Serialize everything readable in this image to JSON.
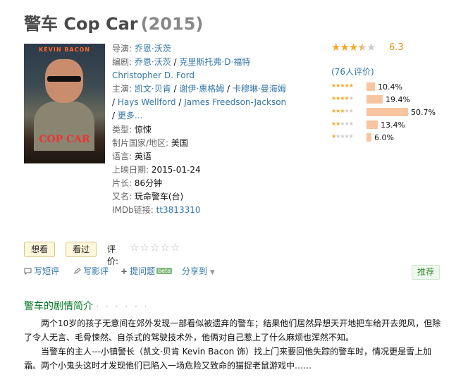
{
  "title": {
    "cn": "警车 Cop Car",
    "year": "(2015)"
  },
  "poster": {
    "actor": "KEVIN BACON",
    "name": "COP CAR"
  },
  "info": {
    "director_label": "导演:",
    "director": "乔恩·沃茨",
    "writer_label": "编剧:",
    "writer1": "乔恩·沃茨",
    "writer2": "克里斯托弗·D·福特 Christopher D. Ford",
    "cast_label": "主演:",
    "cast1": "凯文·贝肯",
    "cast2": "谢伊·惠格姆",
    "cast3": "卡穆琳·曼海姆",
    "cast4": "Hays Wellford",
    "cast5": "James Freedson-Jackson",
    "more": "更多...",
    "genre_label": "类型:",
    "genre": "惊悚",
    "country_label": "制片国家/地区:",
    "country": "美国",
    "lang_label": "语言:",
    "lang": "英语",
    "release_label": "上映日期:",
    "release": "2015-01-24",
    "runtime_label": "片长:",
    "runtime": "86分钟",
    "aka_label": "又名:",
    "aka": "玩命警车(台)",
    "imdb_label": "IMDb链接:",
    "imdb": "tt3813310"
  },
  "rating": {
    "score": "6.3",
    "stars_value": 3.5,
    "votes": "(76人评价)",
    "distribution": [
      {
        "stars": 5,
        "percent": 10.4,
        "label": "10.4%"
      },
      {
        "stars": 4,
        "percent": 19.4,
        "label": "19.4%"
      },
      {
        "stars": 3,
        "percent": 50.7,
        "label": "50.7%"
      },
      {
        "stars": 2,
        "percent": 13.4,
        "label": "13.4%"
      },
      {
        "stars": 1,
        "percent": 6.0,
        "label": "6.0%"
      }
    ]
  },
  "actions": {
    "want": "想看",
    "seen": "看过",
    "rate_label": "评价:"
  },
  "tools": {
    "short_review": "写短评",
    "review": "写影评",
    "question": "提问题",
    "beta": "beta",
    "share": "分享到",
    "recommend": "推荐"
  },
  "summary": {
    "title": "警车的剧情简介",
    "dots": "· · · · · ·",
    "p1": "两个10岁的孩子无意间在郊外发现一部看似被遗弃的警车；结果他们居然异想天开地把车给开去兜风，但除了令人无言、毛骨悚然、自杀式的驾驶技术外，他俩对自己惹上了什么麻烦也浑然不知。",
    "p2": "当警车的主人---小镇警长（凯文·贝肯 Kevin Bacon 饰）找上门来要回他失踪的警车时，情况更是雪上加霜。两个小鬼头这时才发现他们已陷入一场危险又致命的猫捉老鼠游戏中……"
  }
}
